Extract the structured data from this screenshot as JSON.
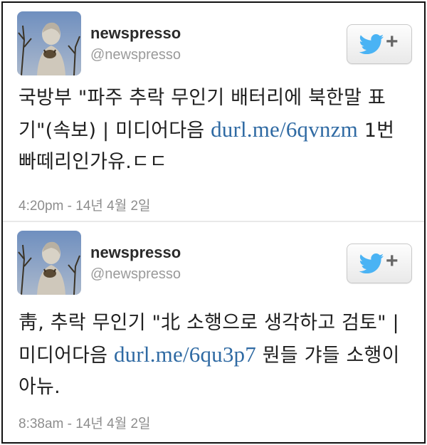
{
  "colors": {
    "link": "#2f6aa3",
    "twitter_blue": "#4ab3f4",
    "meta_text": "#8d8d8d"
  },
  "tweets": [
    {
      "user": {
        "name": "newspresso",
        "handle": "@newspresso"
      },
      "follow_button": {
        "icon": "twitter-bird-icon",
        "plus": "+"
      },
      "text_before_link": "국방부 \"파주 추락 무인기 배터리에 북한말 표기\"(속보) | 미디어다음 ",
      "link": "durl.me/6qvnzm",
      "text_after_link": " 1번 빠떼리인가유.ㄷㄷ",
      "timestamp": "4:20pm - 14년 4월 2일"
    },
    {
      "user": {
        "name": "newspresso",
        "handle": "@newspresso"
      },
      "follow_button": {
        "icon": "twitter-bird-icon",
        "plus": "+"
      },
      "text_before_link": "靑, 추락 무인기 \"北 소행으로 생각하고 검토\" | 미디어다음 ",
      "link": "durl.me/6qu3p7",
      "text_after_link": " 뭔들 갸들 소행이 아뉴.",
      "timestamp": "8:38am - 14년 4월 2일"
    }
  ]
}
